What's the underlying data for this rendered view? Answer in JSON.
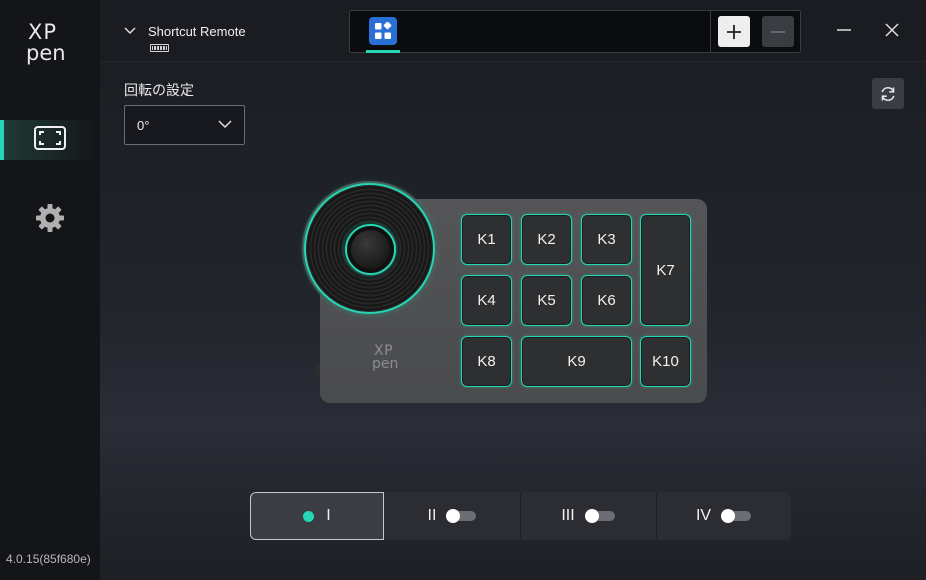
{
  "app": {
    "version": "4.0.15(85f680e)",
    "logo_xp": "XP",
    "logo_pen": "pen"
  },
  "header": {
    "device_name": "Shortcut Remote",
    "add_label": "+",
    "remove_label": "−"
  },
  "settings": {
    "rotation_label": "回転の設定",
    "rotation_value": "0°"
  },
  "device": {
    "logo_xp": "XP",
    "logo_pen": "pen",
    "keys": [
      "K1",
      "K2",
      "K3",
      "K4",
      "K5",
      "K6",
      "K7",
      "K8",
      "K9",
      "K10"
    ]
  },
  "profiles": [
    {
      "label": "I",
      "active": true
    },
    {
      "label": "II",
      "active": false
    },
    {
      "label": "III",
      "active": false
    },
    {
      "label": "IV",
      "active": false
    }
  ],
  "colors": {
    "accent": "#25d6b4",
    "app_tile": "#2a6fd6",
    "background": "#1a1c22"
  },
  "icons": {
    "nav_1": "fullscreen-frame-icon",
    "nav_2": "gear-icon",
    "app_tab": "apps-grid-icon",
    "reset": "refresh-icon"
  }
}
